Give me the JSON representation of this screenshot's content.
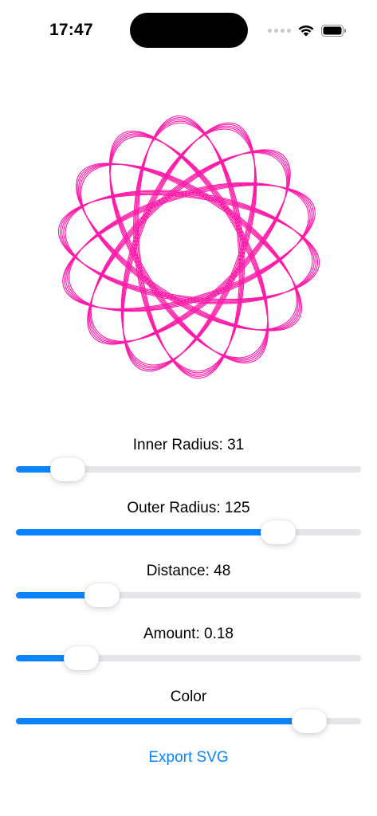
{
  "status_bar": {
    "time": "17:47",
    "icons": [
      "signal-dots-icon",
      "wifi-icon",
      "battery-icon"
    ]
  },
  "spirograph": {
    "color": "#ff1aa8",
    "inner_radius": 31,
    "outer_radius": 125,
    "distance": 48,
    "amount": 0.18
  },
  "controls": {
    "inner_radius": {
      "label": "Inner Radius: 31",
      "fraction": 0.15
    },
    "outer_radius": {
      "label": "Outer Radius: 125",
      "fraction": 0.76
    },
    "distance": {
      "label": "Distance: 48",
      "fraction": 0.25
    },
    "amount": {
      "label": "Amount: 0.18",
      "fraction": 0.19
    },
    "color": {
      "label": "Color",
      "fraction": 0.85
    }
  },
  "export": {
    "label": "Export SVG"
  },
  "colors": {
    "accent": "#0a84ff",
    "track": "#e5e5ea",
    "stroke": "#ff1aa8"
  }
}
